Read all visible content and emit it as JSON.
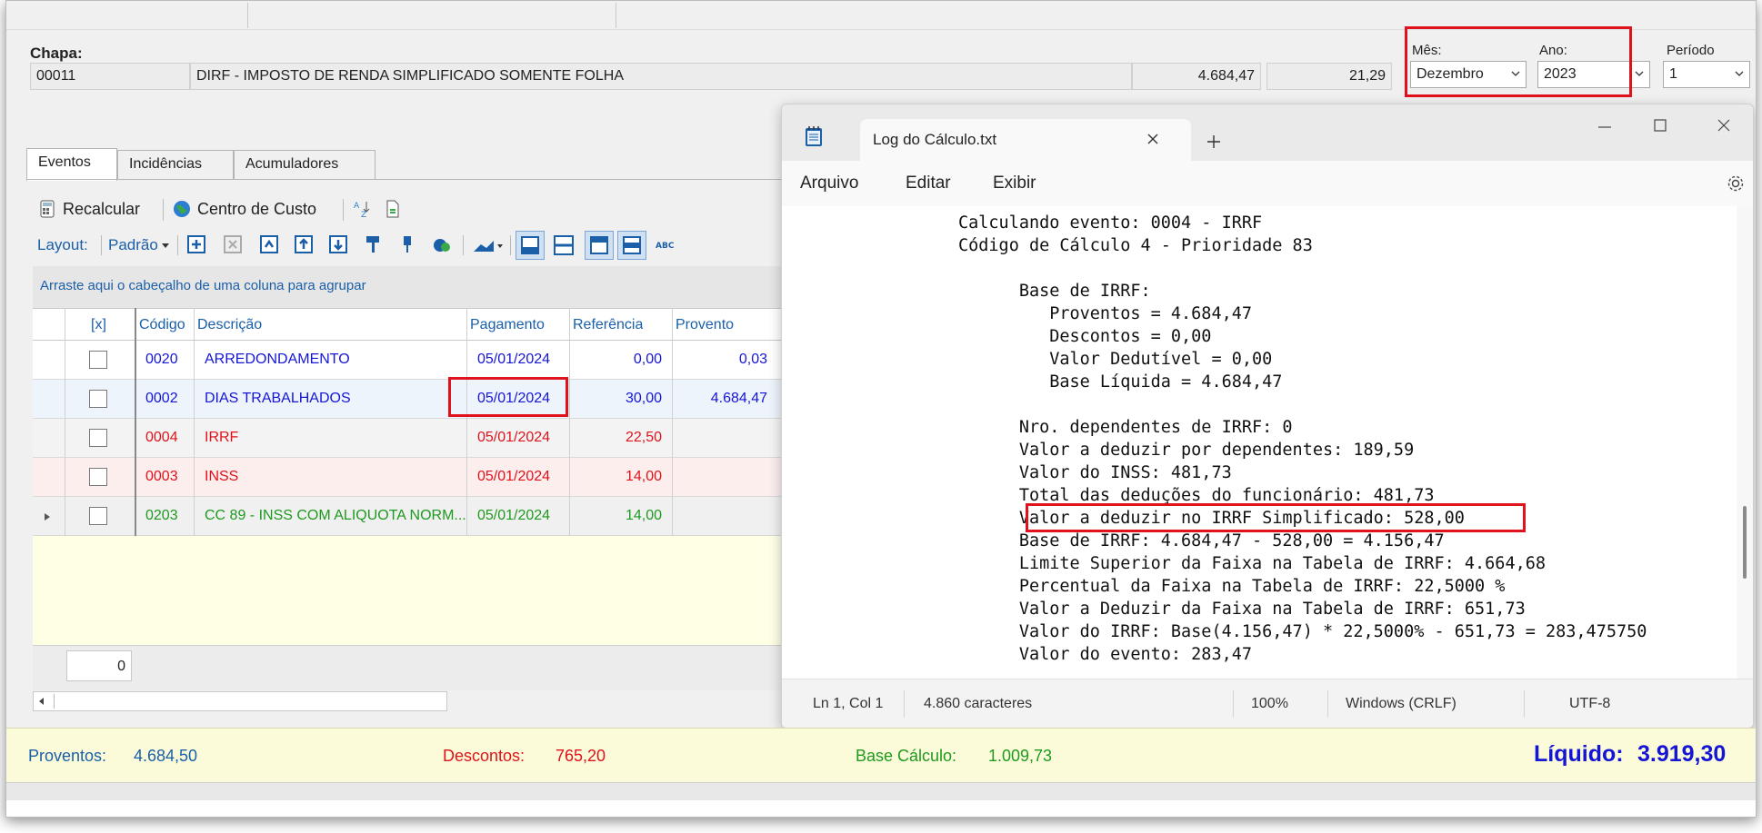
{
  "header": {
    "chapa_label": "Chapa:",
    "chapa_value": "00011",
    "evento_descricao": "DIRF - IMPOSTO DE RENDA SIMPLIFICADO SOMENTE FOLHA",
    "valor": "4.684,47",
    "referencia": "21,29",
    "mes_label": "Mês:",
    "mes_value": "Dezembro",
    "ano_label": "Ano:",
    "ano_value": "2023",
    "periodo_label": "Período",
    "periodo_value": "1"
  },
  "tabs": [
    "Eventos",
    "Incidências",
    "Acumuladores"
  ],
  "toolbar": {
    "recalcular": "Recalcular",
    "centro_custo": "Centro de Custo",
    "layout_label": "Layout:",
    "layout_value": "Padrão"
  },
  "grid": {
    "group_hint": "Arraste aqui o cabeçalho de uma coluna para agrupar",
    "columns": [
      "[x]",
      "Código",
      "Descrição",
      "Pagamento",
      "Referência",
      "Provento"
    ],
    "rows": [
      {
        "codigo": "0020",
        "descricao": "ARREDONDAMENTO",
        "pagamento": "05/01/2024",
        "referencia": "0,00",
        "provento": "0,03",
        "color": "#1515d6"
      },
      {
        "codigo": "0002",
        "descricao": "DIAS TRABALHADOS",
        "pagamento": "05/01/2024",
        "referencia": "30,00",
        "provento": "4.684,47",
        "color": "#1515d6"
      },
      {
        "codigo": "0004",
        "descricao": "IRRF",
        "pagamento": "05/01/2024",
        "referencia": "22,50",
        "provento": "",
        "color": "#e0121b"
      },
      {
        "codigo": "0003",
        "descricao": "INSS",
        "pagamento": "05/01/2024",
        "referencia": "14,00",
        "provento": "",
        "color": "#e0121b"
      },
      {
        "codigo": "0203",
        "descricao": "CC 89 - INSS COM ALIQUOTA NORM...",
        "pagamento": "05/01/2024",
        "referencia": "14,00",
        "provento": "",
        "color": "#1e9a1e"
      }
    ],
    "footer_count": "0"
  },
  "notepad": {
    "title": "Log do Cálculo.txt",
    "menu": [
      "Arquivo",
      "Editar",
      "Exibir"
    ],
    "lines": [
      "Calculando evento: 0004 - IRRF",
      "Código de Cálculo 4 - Prioridade 83",
      "",
      "      Base de IRRF:",
      "         Proventos = 4.684,47",
      "         Descontos = 0,00",
      "         Valor Dedutível = 0,00",
      "         Base Líquida = 4.684,47",
      "",
      "      Nro. dependentes de IRRF: 0",
      "      Valor a deduzir por dependentes: 189,59",
      "      Valor do INSS: 481,73",
      "      Total das deduções do funcionário: 481,73",
      "      Valor a deduzir no IRRF Simplificado: 528,00",
      "      Base de IRRF: 4.684,47 - 528,00 = 4.156,47",
      "      Limite Superior da Faixa na Tabela de IRRF: 4.664,68",
      "      Percentual da Faixa na Tabela de IRRF: 22,5000 %",
      "      Valor a Deduzir da Faixa na Tabela de IRRF: 651,73",
      "      Valor do IRRF: Base(4.156,47) * 22,5000% - 651,73 = 283,475750",
      "      Valor do evento: 283,47"
    ],
    "status": {
      "position": "Ln 1, Col 1",
      "chars": "4.860 caracteres",
      "zoom": "100%",
      "eol": "Windows (CRLF)",
      "encoding": "UTF-8"
    }
  },
  "summary": {
    "proventos_label": "Proventos:",
    "proventos_value": "4.684,50",
    "descontos_label": "Descontos:",
    "descontos_value": "765,20",
    "base_label": "Base Cálculo:",
    "base_value": "1.009,73",
    "liquido_label": "Líquido:",
    "liquido_value": "3.919,30"
  },
  "colors": {
    "highlight_red": "#e0121b",
    "link_blue": "#1a5fa8",
    "proventos_blue": "#1515d6",
    "green": "#1e9a1e"
  }
}
